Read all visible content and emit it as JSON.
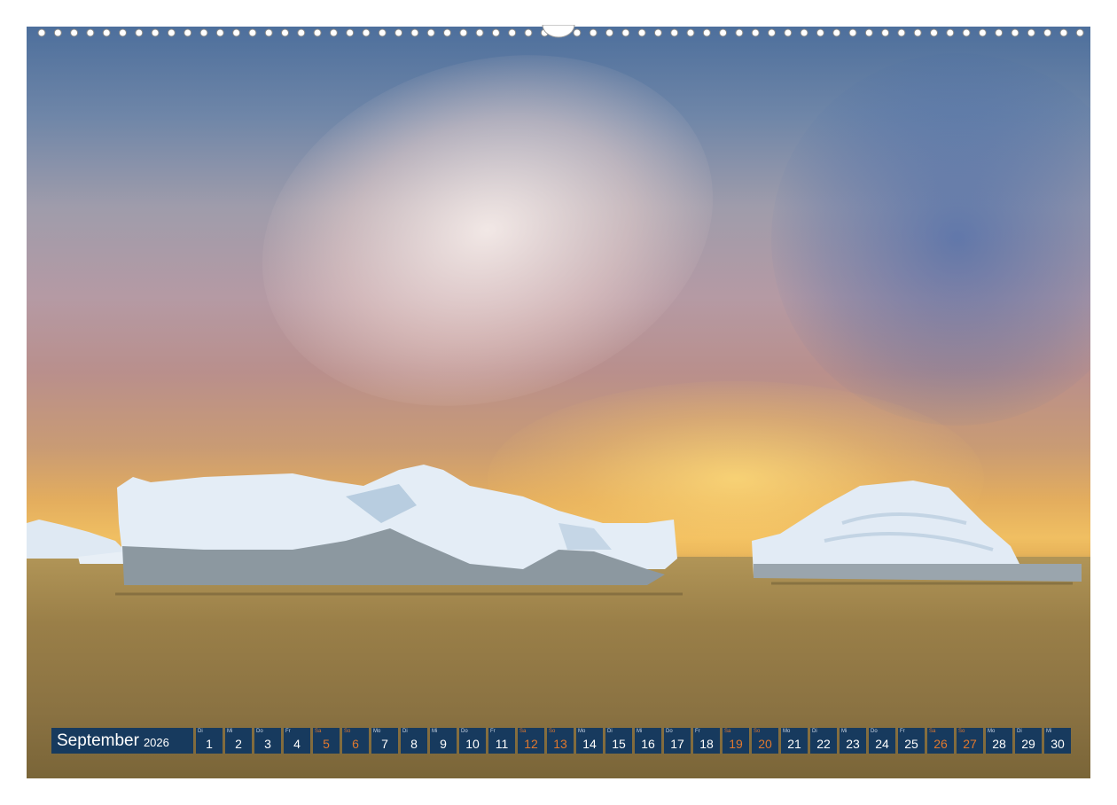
{
  "calendar": {
    "month": "September",
    "year": "2026",
    "days": [
      {
        "wd": "Di",
        "n": "1",
        "we": false
      },
      {
        "wd": "Mi",
        "n": "2",
        "we": false
      },
      {
        "wd": "Do",
        "n": "3",
        "we": false
      },
      {
        "wd": "Fr",
        "n": "4",
        "we": false
      },
      {
        "wd": "Sa",
        "n": "5",
        "we": true
      },
      {
        "wd": "So",
        "n": "6",
        "we": true
      },
      {
        "wd": "Mo",
        "n": "7",
        "we": false
      },
      {
        "wd": "Di",
        "n": "8",
        "we": false
      },
      {
        "wd": "Mi",
        "n": "9",
        "we": false
      },
      {
        "wd": "Do",
        "n": "10",
        "we": false
      },
      {
        "wd": "Fr",
        "n": "11",
        "we": false
      },
      {
        "wd": "Sa",
        "n": "12",
        "we": true
      },
      {
        "wd": "So",
        "n": "13",
        "we": true
      },
      {
        "wd": "Mo",
        "n": "14",
        "we": false
      },
      {
        "wd": "Di",
        "n": "15",
        "we": false
      },
      {
        "wd": "Mi",
        "n": "16",
        "we": false
      },
      {
        "wd": "Do",
        "n": "17",
        "we": false
      },
      {
        "wd": "Fr",
        "n": "18",
        "we": false
      },
      {
        "wd": "Sa",
        "n": "19",
        "we": true
      },
      {
        "wd": "So",
        "n": "20",
        "we": true
      },
      {
        "wd": "Mo",
        "n": "21",
        "we": false
      },
      {
        "wd": "Di",
        "n": "22",
        "we": false
      },
      {
        "wd": "Mi",
        "n": "23",
        "we": false
      },
      {
        "wd": "Do",
        "n": "24",
        "we": false
      },
      {
        "wd": "Fr",
        "n": "25",
        "we": false
      },
      {
        "wd": "Sa",
        "n": "26",
        "we": true
      },
      {
        "wd": "So",
        "n": "27",
        "we": true
      },
      {
        "wd": "Mo",
        "n": "28",
        "we": false
      },
      {
        "wd": "Di",
        "n": "29",
        "we": false
      },
      {
        "wd": "Mi",
        "n": "30",
        "we": false
      }
    ]
  },
  "colors": {
    "calendar_bg": "#173a5e",
    "weekend_text": "#e0782e"
  }
}
